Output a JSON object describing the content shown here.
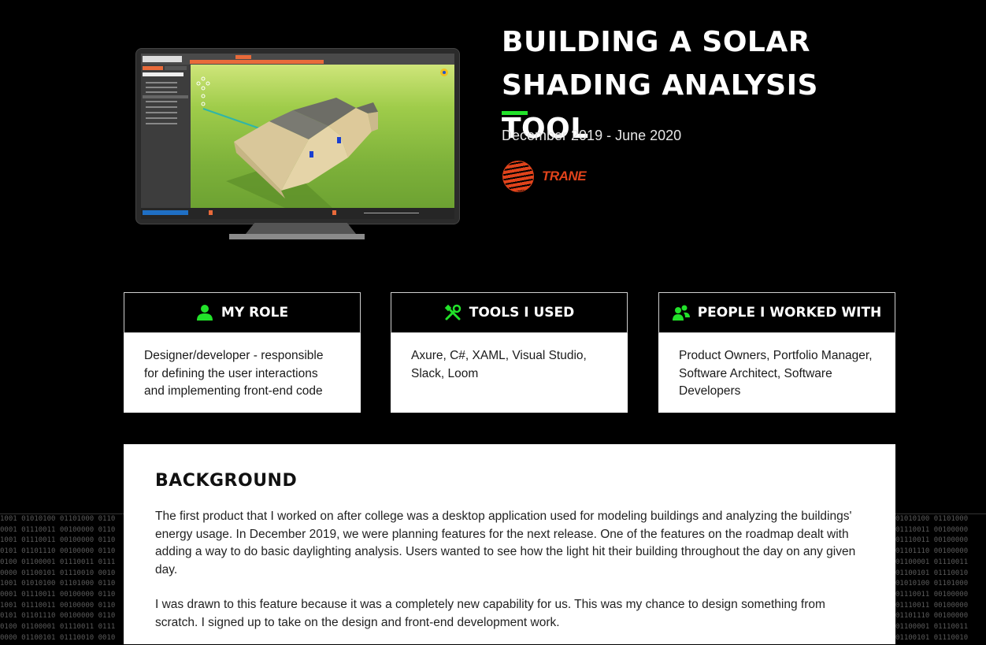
{
  "header": {
    "title_line1": "BUILDING A SOLAR",
    "title_line2": "SHADING ANALYSIS TOOL",
    "dates": "December 2019 - June 2020",
    "company_logo": "TRANE"
  },
  "colors": {
    "accent_green": "#22e22a",
    "trane_red": "#e0431b",
    "background": "#000000"
  },
  "cards": [
    {
      "icon": "user-icon",
      "title": "MY ROLE",
      "body": "Designer/developer - responsible for defining the user interactions and implementing front-end code"
    },
    {
      "icon": "tools-icon",
      "title": "TOOLS I USED",
      "body": "Axure, C#, XAML, Visual Studio, Slack, Loom"
    },
    {
      "icon": "people-icon",
      "title": "PEOPLE I WORKED WITH",
      "body": "Product Owners, Portfolio Manager, Software Architect, Software Developers"
    }
  ],
  "background": {
    "heading": "BACKGROUND",
    "paragraph1": "The first product that I worked on after college was a desktop application used for modeling buildings and analyzing the buildings' energy usage. In December 2019, we were planning features for the next release. One of the features on the roadmap dealt with adding a way to do basic daylighting analysis. Users wanted to see how the light hit their building throughout the day on any given day.",
    "paragraph2": "I was drawn to this feature because it was a completely new capability for us. This was my chance to design something from scratch. I signed up to take on the design and front-end development work."
  }
}
